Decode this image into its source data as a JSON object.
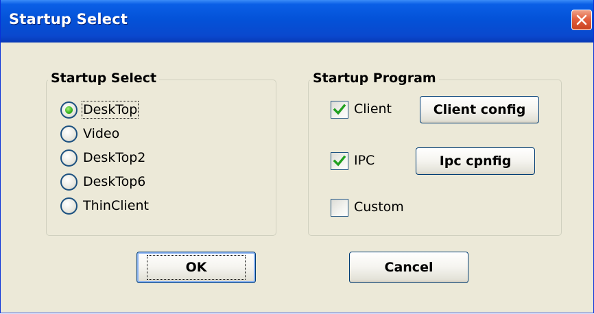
{
  "window": {
    "title": "Startup Select"
  },
  "startup_select": {
    "legend": "Startup Select",
    "options": [
      {
        "label": "DeskTop",
        "selected": true
      },
      {
        "label": "Video",
        "selected": false
      },
      {
        "label": "DeskTop2",
        "selected": false
      },
      {
        "label": "DeskTop6",
        "selected": false
      },
      {
        "label": "ThinClient",
        "selected": false
      }
    ]
  },
  "startup_program": {
    "legend": "Startup Program",
    "items": [
      {
        "label": "Client",
        "checked": true,
        "config_button": "Client config"
      },
      {
        "label": "IPC",
        "checked": true,
        "config_button": "Ipc cpnfig"
      },
      {
        "label": "Custom",
        "checked": false
      }
    ]
  },
  "buttons": {
    "ok": "OK",
    "cancel": "Cancel"
  },
  "colors": {
    "titlebar": "#0452d8",
    "face": "#ece9d8",
    "check": "#21a121",
    "radio_dot": "#35b21c",
    "close": "#e3603f"
  }
}
